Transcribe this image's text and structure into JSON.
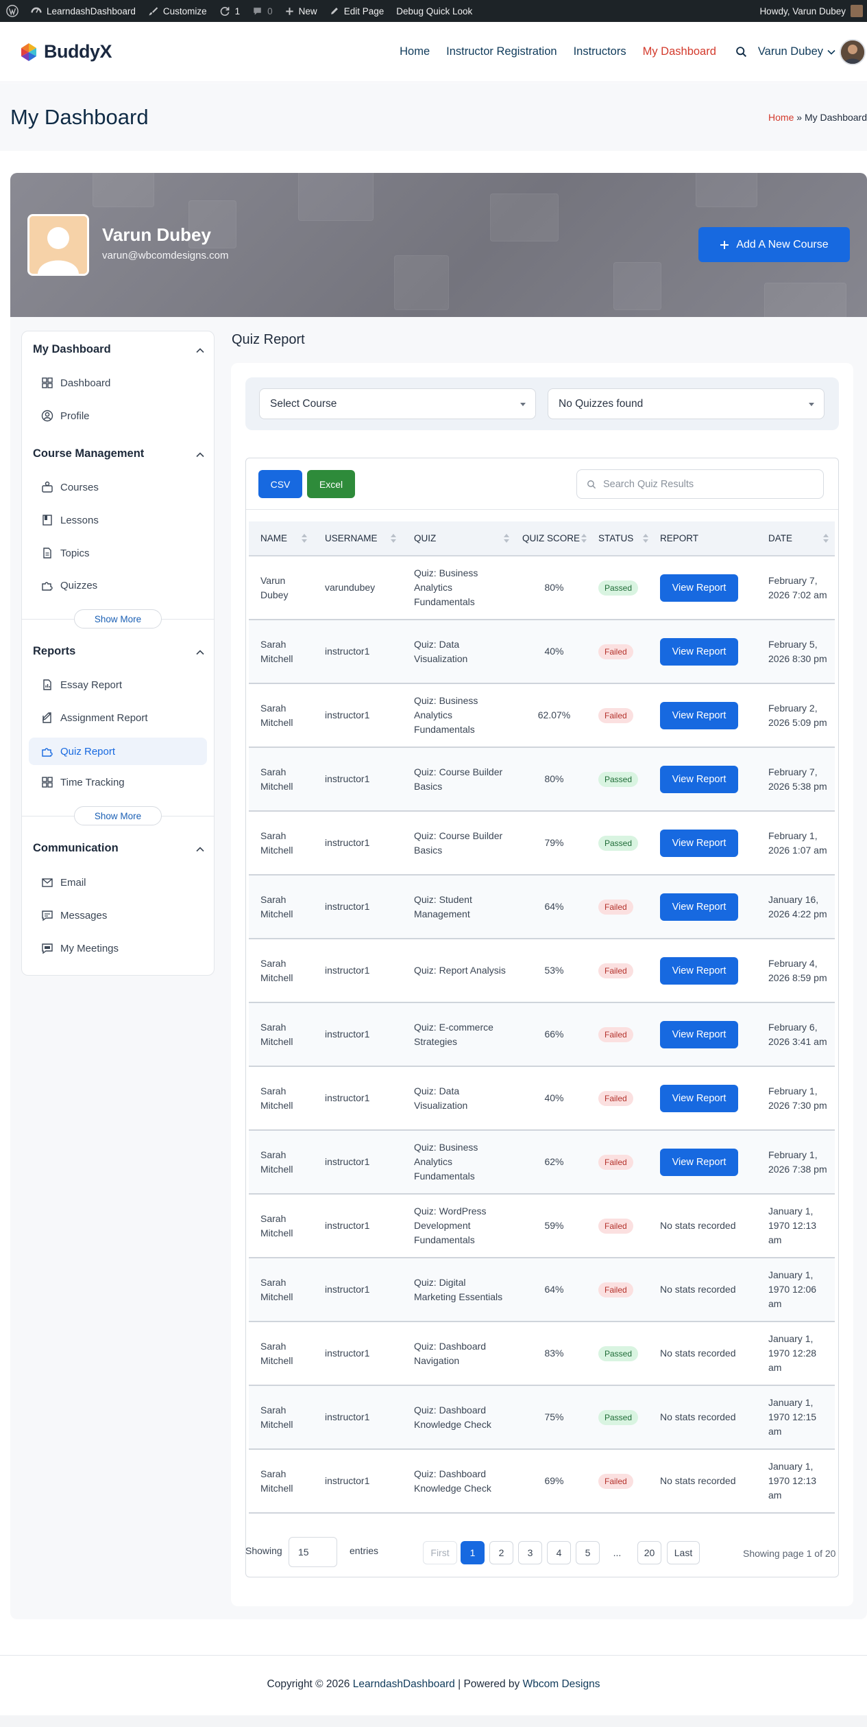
{
  "adminbar": {
    "site": "LearndashDashboard",
    "customize": "Customize",
    "updates": "1",
    "comments": "0",
    "new": "New",
    "edit_page": "Edit Page",
    "debug": "Debug Quick Look",
    "howdy": "Howdy, Varun Dubey"
  },
  "header": {
    "logo": "BuddyX",
    "nav": [
      "Home",
      "Instructor Registration",
      "Instructors",
      "My Dashboard"
    ],
    "user": "Varun Dubey"
  },
  "page": {
    "title": "My Dashboard",
    "breadcrumb_home": "Home",
    "breadcrumb_sep": "»",
    "breadcrumb_current": "My Dashboard"
  },
  "profile": {
    "name": "Varun Dubey",
    "email": "varun@wbcomdesigns.com",
    "add_course": "Add A New Course"
  },
  "sidebar": {
    "sections": [
      {
        "title": "My Dashboard",
        "items": [
          "Dashboard",
          "Profile"
        ]
      },
      {
        "title": "Course Management",
        "items": [
          "Courses",
          "Lessons",
          "Topics",
          "Quizzes"
        ]
      },
      {
        "title": "Reports",
        "items": [
          "Essay Report",
          "Assignment Report",
          "Quiz Report",
          "Time Tracking"
        ]
      },
      {
        "title": "Communication",
        "items": [
          "Email",
          "Messages",
          "My Meetings"
        ]
      }
    ],
    "show_more": "Show More"
  },
  "main": {
    "title": "Quiz Report",
    "select_course": "Select Course",
    "select_quiz": "No Quizzes found",
    "csv": "CSV",
    "excel": "Excel",
    "search_placeholder": "Search Quiz Results"
  },
  "table": {
    "headers": [
      "NAME",
      "USERNAME",
      "QUIZ",
      "QUIZ SCORE",
      "STATUS",
      "REPORT",
      "DATE"
    ],
    "view_report": "View Report",
    "rows": [
      {
        "name": "Varun Dubey",
        "username": "varundubey",
        "quiz": "Quiz: Business Analytics Fundamentals",
        "score": "80%",
        "status": "Passed",
        "report": "btn",
        "date": "February 7, 2026 7:02 am"
      },
      {
        "name": "Sarah Mitchell",
        "username": "instructor1",
        "quiz": "Quiz: Data Visualization",
        "score": "40%",
        "status": "Failed",
        "report": "btn",
        "date": "February 5, 2026 8:30 pm"
      },
      {
        "name": "Sarah Mitchell",
        "username": "instructor1",
        "quiz": "Quiz: Business Analytics Fundamentals",
        "score": "62.07%",
        "status": "Failed",
        "report": "btn",
        "date": "February 2, 2026 5:09 pm"
      },
      {
        "name": "Sarah Mitchell",
        "username": "instructor1",
        "quiz": "Quiz: Course Builder Basics",
        "score": "80%",
        "status": "Passed",
        "report": "btn",
        "date": "February 7, 2026 5:38 pm"
      },
      {
        "name": "Sarah Mitchell",
        "username": "instructor1",
        "quiz": "Quiz: Course Builder Basics",
        "score": "79%",
        "status": "Passed",
        "report": "btn",
        "date": "February 1, 2026 1:07 am"
      },
      {
        "name": "Sarah Mitchell",
        "username": "instructor1",
        "quiz": "Quiz: Student Management",
        "score": "64%",
        "status": "Failed",
        "report": "btn",
        "date": "January 16, 2026 4:22 pm"
      },
      {
        "name": "Sarah Mitchell",
        "username": "instructor1",
        "quiz": "Quiz: Report Analysis",
        "score": "53%",
        "status": "Failed",
        "report": "btn",
        "date": "February 4, 2026 8:59 pm"
      },
      {
        "name": "Sarah Mitchell",
        "username": "instructor1",
        "quiz": "Quiz: E-commerce Strategies",
        "score": "66%",
        "status": "Failed",
        "report": "btn",
        "date": "February 6, 2026 3:41 am"
      },
      {
        "name": "Sarah Mitchell",
        "username": "instructor1",
        "quiz": "Quiz: Data Visualization",
        "score": "40%",
        "status": "Failed",
        "report": "btn",
        "date": "February 1, 2026 7:30 pm"
      },
      {
        "name": "Sarah Mitchell",
        "username": "instructor1",
        "quiz": "Quiz: Business Analytics Fundamentals",
        "score": "62%",
        "status": "Failed",
        "report": "btn",
        "date": "February 1, 2026 7:38 pm"
      },
      {
        "name": "Sarah Mitchell",
        "username": "instructor1",
        "quiz": "Quiz: WordPress Development Fundamentals",
        "score": "59%",
        "status": "Failed",
        "report": "No stats recorded",
        "date": "January 1, 1970 12:13 am"
      },
      {
        "name": "Sarah Mitchell",
        "username": "instructor1",
        "quiz": "Quiz: Digital Marketing Essentials",
        "score": "64%",
        "status": "Failed",
        "report": "No stats recorded",
        "date": "January 1, 1970 12:06 am"
      },
      {
        "name": "Sarah Mitchell",
        "username": "instructor1",
        "quiz": "Quiz: Dashboard Navigation",
        "score": "83%",
        "status": "Passed",
        "report": "No stats recorded",
        "date": "January 1, 1970 12:28 am"
      },
      {
        "name": "Sarah Mitchell",
        "username": "instructor1",
        "quiz": "Quiz: Dashboard Knowledge Check",
        "score": "75%",
        "status": "Passed",
        "report": "No stats recorded",
        "date": "January 1, 1970 12:15 am"
      },
      {
        "name": "Sarah Mitchell",
        "username": "instructor1",
        "quiz": "Quiz: Dashboard Knowledge Check",
        "score": "69%",
        "status": "Failed",
        "report": "No stats recorded",
        "date": "January 1, 1970 12:13 am"
      }
    ]
  },
  "pagination": {
    "showing": "Showing",
    "entries_value": "15",
    "entries": "entries",
    "first": "First",
    "pages": [
      "1",
      "2",
      "3",
      "4",
      "5"
    ],
    "ellipsis": "...",
    "last_page": "20",
    "last": "Last",
    "info": "Showing page 1 of 20"
  },
  "footer": {
    "copyright": "Copyright © 2026",
    "site": "LearndashDashboard",
    "powered": "| Powered by",
    "company": "Wbcom Designs"
  },
  "colors": {
    "primary": "#1769e0",
    "excel": "#2e8b3a",
    "active_nav": "#d33a2c",
    "passed_bg": "#d9f4e1",
    "failed_bg": "#fbe0e0"
  }
}
